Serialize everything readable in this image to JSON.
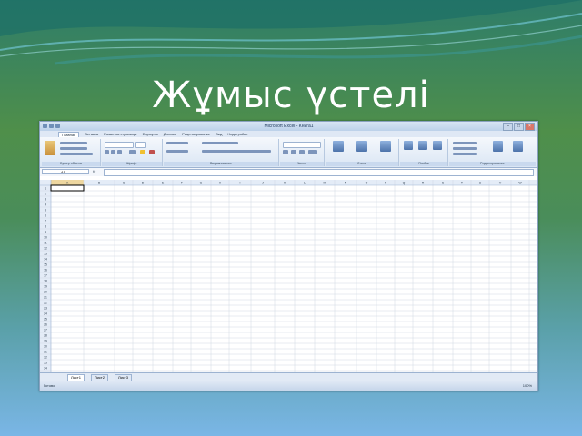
{
  "slide": {
    "title": "Жұмыс үстелі"
  },
  "window": {
    "title": "Microsoft Excel - Книга1",
    "controls": [
      "–",
      "□",
      "×"
    ]
  },
  "ribbon": {
    "tabs": [
      "Главная",
      "Вставка",
      "Разметка страницы",
      "Формулы",
      "Данные",
      "Рецензирование",
      "Вид",
      "Надстройки"
    ],
    "groups": [
      "Буфер обмена",
      "Шрифт",
      "Выравнивание",
      "Число",
      "Стили",
      "Ячейки",
      "Редактирование"
    ]
  },
  "formula_bar": {
    "name_box": "A1",
    "fx": "fx",
    "content": ""
  },
  "sheet": {
    "columns": [
      "A",
      "B",
      "C",
      "D",
      "E",
      "F",
      "G",
      "H",
      "I",
      "J",
      "K",
      "L",
      "M",
      "N",
      "O",
      "P",
      "Q",
      "R",
      "S",
      "T",
      "U",
      "V",
      "W"
    ],
    "rows": [
      "1",
      "2",
      "3",
      "4",
      "5",
      "6",
      "7",
      "8",
      "9",
      "10",
      "11",
      "12",
      "13",
      "14",
      "15",
      "16",
      "17",
      "18",
      "19",
      "20",
      "21",
      "22",
      "23",
      "24",
      "25",
      "26",
      "27",
      "28",
      "29",
      "30",
      "31",
      "32",
      "33",
      "34",
      "35",
      "36",
      "37"
    ],
    "tabs": [
      "Лист1",
      "Лист2",
      "Лист3"
    ]
  },
  "status_bar": {
    "status": "Готово",
    "zoom": "100%"
  },
  "colors": {
    "accent": "#9db3d1",
    "active_cell": "#f6c75a"
  }
}
